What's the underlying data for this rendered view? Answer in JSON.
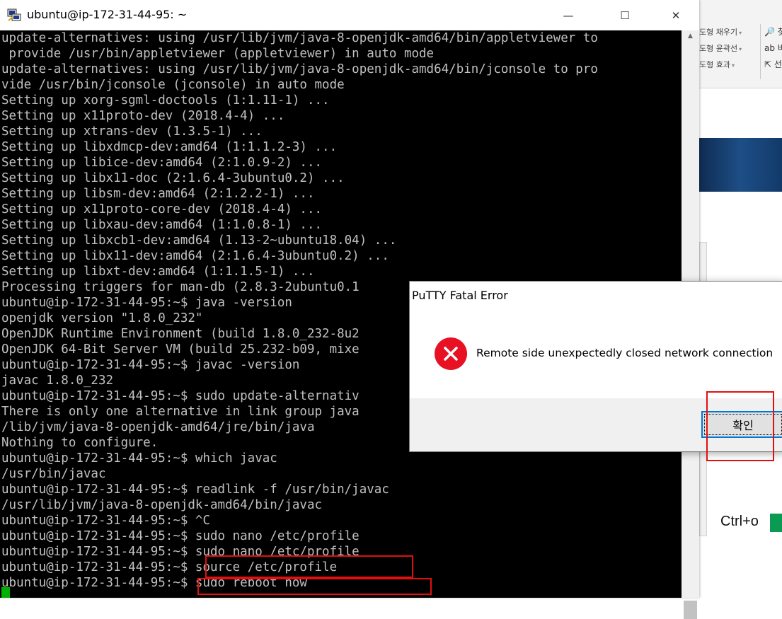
{
  "window": {
    "title": "ubuntu@ip-172-31-44-95: ~",
    "icon": "putty-icon",
    "controls": {
      "minimize": "—",
      "maximize": "☐",
      "close": "✕"
    }
  },
  "terminal": {
    "lines": [
      "update-alternatives: using /usr/lib/jvm/java-8-openjdk-amd64/bin/appletviewer to",
      " provide /usr/bin/appletviewer (appletviewer) in auto mode",
      "update-alternatives: using /usr/lib/jvm/java-8-openjdk-amd64/bin/jconsole to pro",
      "vide /usr/bin/jconsole (jconsole) in auto mode",
      "Setting up xorg-sgml-doctools (1:1.11-1) ...",
      "Setting up x11proto-dev (2018.4-4) ...",
      "Setting up xtrans-dev (1.3.5-1) ...",
      "Setting up libxdmcp-dev:amd64 (1:1.1.2-3) ...",
      "Setting up libice-dev:amd64 (2:1.0.9-2) ...",
      "Setting up libx11-doc (2:1.6.4-3ubuntu0.2) ...",
      "Setting up libsm-dev:amd64 (2:1.2.2-1) ...",
      "Setting up x11proto-core-dev (2018.4-4) ...",
      "Setting up libxau-dev:amd64 (1:1.0.8-1) ...",
      "Setting up libxcb1-dev:amd64 (1.13-2~ubuntu18.04) ...",
      "Setting up libx11-dev:amd64 (2:1.6.4-3ubuntu0.2) ...",
      "Setting up libxt-dev:amd64 (1:1.1.5-1) ...",
      "Processing triggers for man-db (2.8.3-2ubuntu0.1",
      "ubuntu@ip-172-31-44-95:~$ java -version",
      "openjdk version \"1.8.0_232\"",
      "OpenJDK Runtime Environment (build 1.8.0_232-8u2",
      "OpenJDK 64-Bit Server VM (build 25.232-b09, mixe",
      "ubuntu@ip-172-31-44-95:~$ javac -version",
      "javac 1.8.0_232",
      "ubuntu@ip-172-31-44-95:~$ sudo update-alternativ",
      "There is only one alternative in link group java",
      "/lib/jvm/java-8-openjdk-amd64/jre/bin/java",
      "Nothing to configure.",
      "ubuntu@ip-172-31-44-95:~$ which javac",
      "/usr/bin/javac",
      "ubuntu@ip-172-31-44-95:~$ readlink -f /usr/bin/javac",
      "/usr/lib/jvm/java-8-openjdk-amd64/bin/javac",
      "ubuntu@ip-172-31-44-95:~$ ^C",
      "ubuntu@ip-172-31-44-95:~$ sudo nano /etc/profile",
      "ubuntu@ip-172-31-44-95:~$ sudo nano /etc/profile",
      "ubuntu@ip-172-31-44-95:~$ source /etc/profile",
      "ubuntu@ip-172-31-44-95:~$ sudo reboot now"
    ],
    "text_color": "#c0c0c0",
    "background": "#000000",
    "cursor_color": "#00b000"
  },
  "dialog": {
    "title": "PuTTY Fatal Error",
    "message": "Remote side unexpectedly closed network connection",
    "ok_label": "확인",
    "icon": "error-icon",
    "icon_color": "#e81123"
  },
  "background_app": {
    "ribbon": [
      {
        "label": "도형 채우기",
        "dropdown": "▾"
      },
      {
        "label": "도형 윤곽선",
        "dropdown": "▾"
      },
      {
        "label": "도형 효과",
        "dropdown": "▾"
      }
    ],
    "tools": [
      "🔎 찾",
      "ab 바",
      "⇱ 선"
    ],
    "slide_text": "Ctrl+o"
  },
  "annotation_color": "#e01010"
}
